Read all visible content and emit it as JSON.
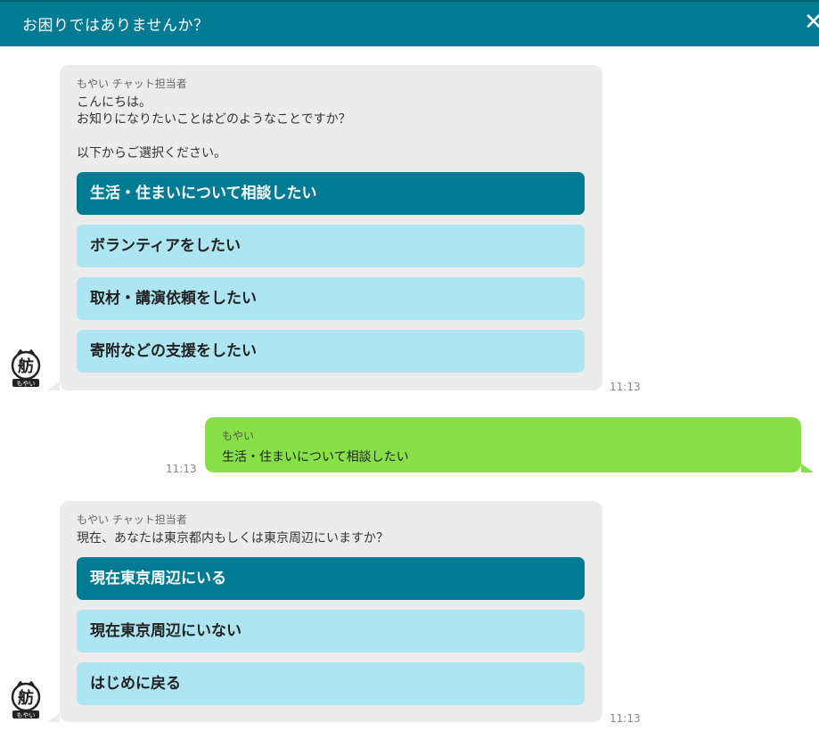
{
  "header": {
    "title": "お困りではありませんか？",
    "close_icon": "close-icon"
  },
  "messages": [
    {
      "type": "bot",
      "sender": "もやい チャット担当者",
      "text": "こんにちは。\nお知りになりたいことはどのようなことですか？\n\n以下からご選択ください。",
      "options": [
        "生活・住まいについて相談したい",
        "ボランティアをしたい",
        "取材・講演依頼をしたい",
        "寄附などの支援をしたい"
      ],
      "selected_index": 0,
      "time": "11:13",
      "avatar_label": "もやい"
    },
    {
      "type": "user",
      "sender": "もやい",
      "text": "生活・住まいについて相談したい",
      "time": "11:13"
    },
    {
      "type": "bot",
      "sender": "もやい チャット担当者",
      "text": "現在、あなたは東京都内もしくは東京周辺にいますか？",
      "options": [
        "現在東京周辺にいる",
        "現在東京周辺にいない",
        "はじめに戻る"
      ],
      "selected_index": 0,
      "time": "11:13",
      "avatar_label": "もやい"
    }
  ],
  "colors": {
    "header": "#017b93",
    "option_selected": "#017b93",
    "option_default": "#ade6f2",
    "bot_bubble": "#ececec",
    "user_bubble": "#87e048"
  }
}
